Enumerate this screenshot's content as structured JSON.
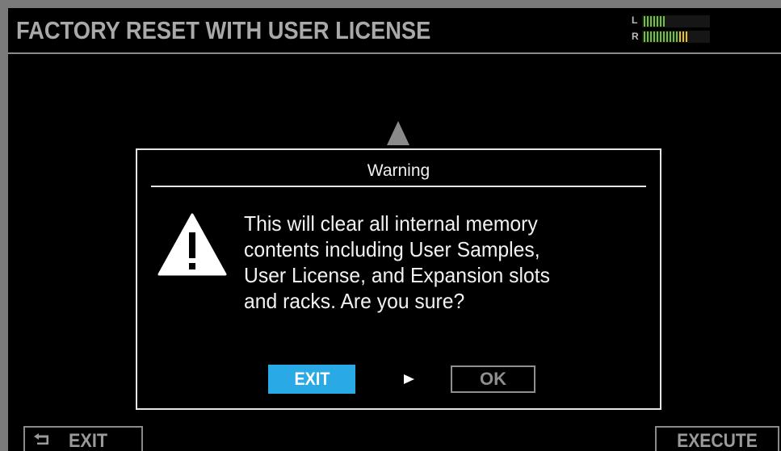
{
  "header": {
    "title": "FACTORY RESET WITH USER LICENSE"
  },
  "level_meter": {
    "left_label": "L",
    "right_label": "R",
    "left_level": 0.35,
    "right_level": 0.65,
    "colors": {
      "green": "#6fc33a",
      "yellow": "#e6c21a",
      "track": "#161616"
    }
  },
  "dialog": {
    "title": "Warning",
    "icon": "warning-triangle-icon",
    "message_lines": [
      "This will clear all internal memory",
      "contents including User Samples,",
      "User License, and Expansion slots",
      "and racks. Are you sure?"
    ],
    "exit_label": "EXIT",
    "ok_label": "OK",
    "selected_button": "EXIT",
    "accent_color": "#29a9e6"
  },
  "footer": {
    "exit_label": "EXIT",
    "exit_icon": "back-arrow-icon",
    "execute_label": "EXECUTE"
  }
}
